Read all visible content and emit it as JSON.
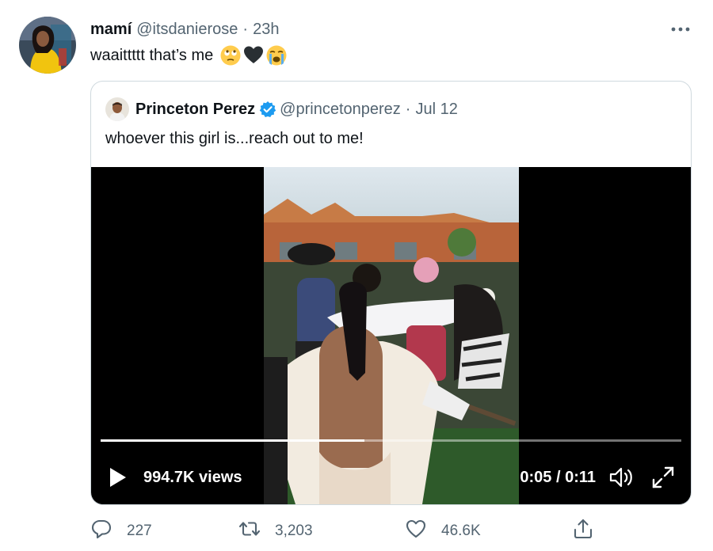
{
  "tweet": {
    "author_name": "mamí",
    "handle": "@itsdanierose",
    "separator": "·",
    "time": "23h",
    "text": "waaittttt that’s me",
    "emojis": [
      "face-with-rolling-eyes",
      "black-heart",
      "loudly-crying-face"
    ]
  },
  "quoted": {
    "author_name": "Princeton Perez",
    "verified": true,
    "handle": "@princetonperez",
    "separator": "·",
    "date": "Jul 12",
    "text": "whoever this girl is...reach out to me!"
  },
  "video": {
    "views": "994.7K views",
    "timecode": "0:05 / 0:11",
    "progress": 0.4545
  },
  "actions": {
    "replies": "227",
    "retweets": "3,203",
    "likes": "46.6K"
  },
  "colors": {
    "text_primary": "#0f1419",
    "text_secondary": "#536471",
    "verified_blue": "#1d9bf0",
    "border": "#cfd9de"
  },
  "icons": [
    "more-icon",
    "verified-icon",
    "play-icon",
    "volume-icon",
    "fullscreen-icon",
    "reply-icon",
    "retweet-icon",
    "like-icon",
    "share-icon"
  ]
}
